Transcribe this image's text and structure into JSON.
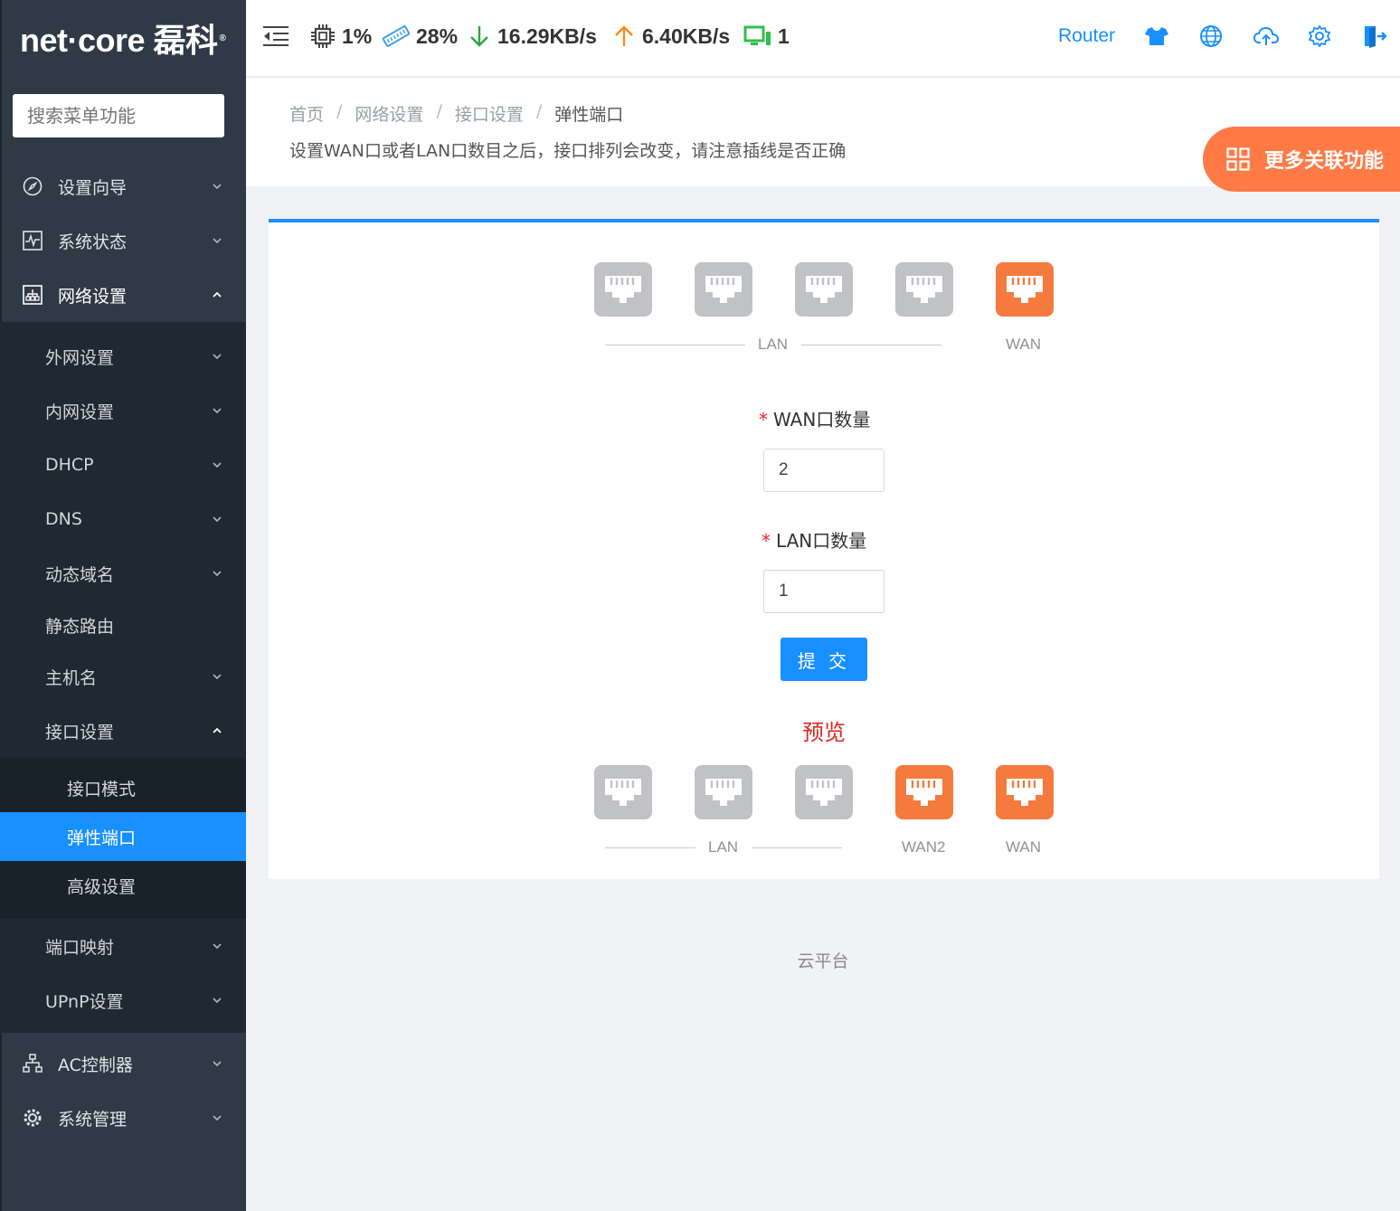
{
  "brand": {
    "logo_text": "net·core 磊科",
    "reg_mark": "®"
  },
  "search": {
    "placeholder": "搜索菜单功能"
  },
  "topbar": {
    "cpu": "1%",
    "mem": "28%",
    "down": "16.29KB/s",
    "up": "6.40KB/s",
    "devices": "1",
    "mode": "Router",
    "colors": {
      "down_arrow": "#27a844",
      "up_arrow": "#fa8c16",
      "device_icon": "#2fbf4a",
      "accent": "#1890ff"
    }
  },
  "menu": {
    "top": [
      {
        "label": "设置向导",
        "icon": "compass-icon"
      },
      {
        "label": "系统状态",
        "icon": "pulse-icon"
      },
      {
        "label": "网络设置",
        "icon": "network-icon"
      }
    ],
    "network_sub": [
      {
        "label": "外网设置"
      },
      {
        "label": "内网设置"
      },
      {
        "label": "DHCP"
      },
      {
        "label": "DNS"
      },
      {
        "label": "动态域名"
      },
      {
        "label": "静态路由"
      },
      {
        "label": "主机名"
      },
      {
        "label": "接口设置"
      }
    ],
    "interface_sub": [
      {
        "label": "接口模式"
      },
      {
        "label": "弹性端口"
      },
      {
        "label": "高级设置"
      }
    ],
    "after": [
      {
        "label": "端口映射"
      },
      {
        "label": "UPnP设置"
      }
    ],
    "bottom": [
      {
        "label": "AC控制器",
        "icon": "tree-icon"
      },
      {
        "label": "系统管理",
        "icon": "gear-icon"
      }
    ]
  },
  "breadcrumb": [
    "首页",
    "网络设置",
    "接口设置",
    "弹性端口"
  ],
  "breadcrumb_sep": "/",
  "notice": "设置WAN口或者LAN口数目之后，接口排列会改变，请注意插线是否正确",
  "more_button": "更多关联功能",
  "ports_current": {
    "lan_label": "LAN",
    "wan_label": "WAN"
  },
  "form": {
    "wan_label": "WAN口数量",
    "wan_value": "2",
    "lan_label": "LAN口数量",
    "lan_value": "1",
    "required_mark": "*",
    "submit": "提 交"
  },
  "preview": {
    "title": "预览",
    "lan_label": "LAN",
    "wan2_label": "WAN2",
    "wan_label": "WAN"
  },
  "footer": "云平台"
}
